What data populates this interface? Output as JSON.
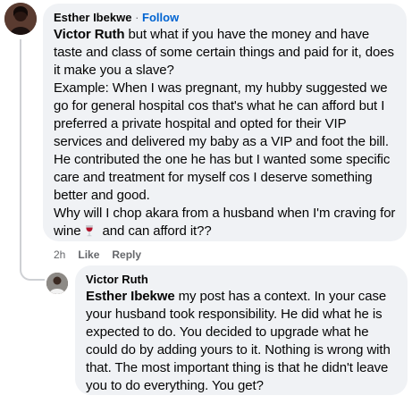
{
  "comment": {
    "author": "Esther Ibekwe",
    "separator": "·",
    "follow_label": "Follow",
    "mention": "Victor Ruth",
    "line1": " but what if you have the money and have taste and class of some certain things and paid for it, does it make you a slave?",
    "line2": "Example: When I was pregnant, my hubby suggested we go for general hospital cos that's what he can afford but I preferred a private hospital and opted for their VIP services and delivered my baby as a VIP and foot the bill. He contributed the one he has but I wanted some specific care and treatment for myself cos I deserve something better and good.",
    "line3_before": "Why will I chop akara from a husband when I'm craving for wine",
    "line3_after": " and can afford it??",
    "emoji_icon": "wine-glass-icon",
    "time": "2h",
    "like_label": "Like",
    "reply_label": "Reply"
  },
  "reply": {
    "author": "Victor Ruth",
    "mention": "Esther Ibekwe",
    "text": " my post has a context. In your case your husband took responsibility. He did what he is expected to do. You decided to upgrade what he could do by adding yours to it. Nothing is wrong with that. The most important thing is that he didn't leave you to do everything. You get?"
  },
  "colors": {
    "bubble": "#f0f2f5",
    "follow": "#0064d1",
    "meta": "#65676b",
    "text": "#050505"
  }
}
